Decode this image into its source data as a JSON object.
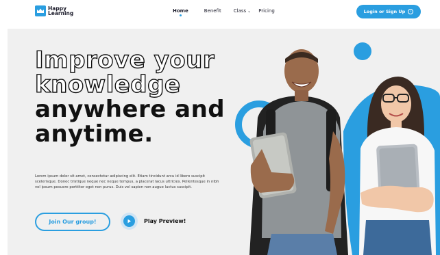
{
  "brand": {
    "name_line1": "Happy",
    "name_line2": "Learning",
    "accent": "#2a9ee0",
    "logo_icon": "crown-icon"
  },
  "nav": {
    "items": [
      {
        "label": "Home",
        "active": true
      },
      {
        "label": "Benefit",
        "active": false
      },
      {
        "label": "Class",
        "active": false,
        "dropdown": true
      },
      {
        "label": "Pricing",
        "active": false
      }
    ],
    "cta_label": "Login or Sign Up",
    "cta_icon": "arrow-right-circle-icon"
  },
  "hero": {
    "headline_outline_1": "Improve your",
    "headline_outline_2": "knowledge",
    "headline_solid_1": "anywhere and",
    "headline_solid_2": "anytime.",
    "body": "Lorem ipsum dolor sit amet, consectetur adipiscing elit. Etiam tincidunt arcu id libero suscipit scelerisque. Donec tristique neque nec neque tempus, a placerat lacus ultricies. Pellentesque in nibh vel ipsum posuere porttitor eget non purus. Duis vel sapien non augue luctus suscipit.",
    "primary_button": "Join Our group!",
    "secondary_button": "Play Preview!",
    "secondary_icon": "play-icon"
  },
  "colors": {
    "hero_bg": "#f0f0f0",
    "text_dark": "#111111"
  }
}
